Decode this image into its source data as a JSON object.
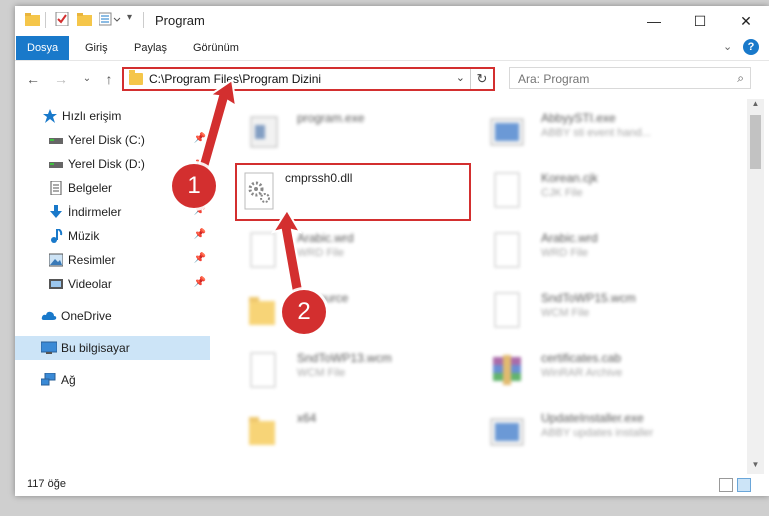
{
  "window": {
    "title": "Program",
    "controls": {
      "minimize": "—",
      "maximize": "☐",
      "close": "✕"
    }
  },
  "ribbon": {
    "tabs": [
      "Dosya",
      "Giriş",
      "Paylaş",
      "Görünüm"
    ],
    "active_tab": "Dosya",
    "expand_glyph": "⌄",
    "help_glyph": "?"
  },
  "nav": {
    "back": "←",
    "forward": "→",
    "recent": "⌄",
    "up": "↑",
    "address": "C:\\Program Files\\Program Dizini",
    "address_dropdown": "⌄",
    "refresh": "↻",
    "search_placeholder": "Ara: Program",
    "search_icon": "⌕"
  },
  "sidebar": {
    "items": [
      {
        "label": "Hızlı erişim",
        "icon": "star-icon",
        "pinned": false
      },
      {
        "label": "Yerel Disk (C:)",
        "icon": "drive-icon",
        "pinned": true
      },
      {
        "label": "Yerel Disk (D:)",
        "icon": "drive-icon",
        "pinned": true
      },
      {
        "label": "Belgeler",
        "icon": "documents-icon",
        "pinned": true
      },
      {
        "label": "İndirmeler",
        "icon": "download-icon",
        "pinned": true
      },
      {
        "label": "Müzik",
        "icon": "music-icon",
        "pinned": true
      },
      {
        "label": "Resimler",
        "icon": "pictures-icon",
        "pinned": true
      },
      {
        "label": "Videolar",
        "icon": "videos-icon",
        "pinned": true
      },
      {
        "label": "OneDrive",
        "icon": "cloud-icon",
        "pinned": false
      },
      {
        "label": "Bu bilgisayar",
        "icon": "computer-icon",
        "pinned": false,
        "selected": true
      },
      {
        "label": "Ağ",
        "icon": "network-icon",
        "pinned": false
      }
    ],
    "pin_glyph": "📌"
  },
  "files": [
    {
      "name": "program.exe",
      "type": "",
      "icon": "exe-icon"
    },
    {
      "name": "AbbyySTI.exe",
      "type": "ABBY sti event hand...",
      "icon": "exe-icon"
    },
    {
      "name": "cmprssh0.dll",
      "type": "",
      "icon": "dll-gear-icon"
    },
    {
      "name": "Korean.cjk",
      "type": "CJK File",
      "icon": "file-icon"
    },
    {
      "name": "Arabic.wrd",
      "type": "WRD File",
      "icon": "file-icon"
    },
    {
      "name": "Arabic.wrd",
      "type": "WRD File",
      "icon": "file-icon"
    },
    {
      "name": "Resource",
      "type": "",
      "icon": "folder-icon"
    },
    {
      "name": "SndToWP15.wcm",
      "type": "WCM File",
      "icon": "file-icon"
    },
    {
      "name": "SndToWP13.wcm",
      "type": "WCM File",
      "icon": "file-icon"
    },
    {
      "name": "certificates.cab",
      "type": "WinRAR Archive",
      "icon": "archive-icon"
    },
    {
      "name": "x64",
      "type": "",
      "icon": "folder-icon"
    },
    {
      "name": "UpdateInstaller.exe",
      "type": "ABBY updates installer",
      "icon": "exe-icon"
    }
  ],
  "status": {
    "item_count": "117 öğe"
  },
  "annotations": {
    "step1": "1",
    "step2": "2"
  },
  "colors": {
    "accent": "#1979ca",
    "highlight": "#d32f2f",
    "selected": "#cce4f7"
  }
}
